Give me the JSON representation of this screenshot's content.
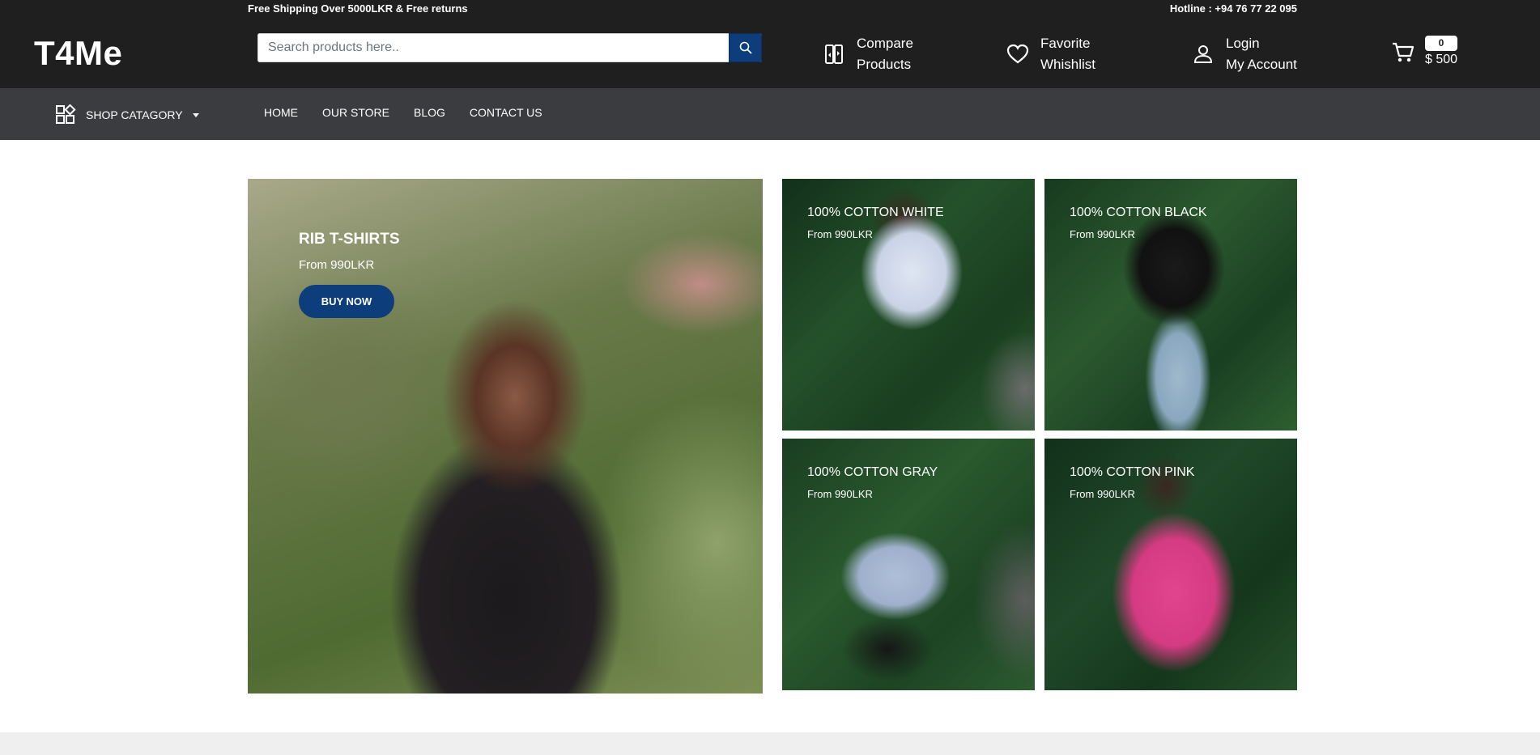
{
  "topbar": {
    "shipping": "Free Shipping Over 5000LKR & Free returns",
    "hotline": "Hotline : +94 76 77 22 095"
  },
  "header": {
    "logo": "T4Me",
    "search": {
      "placeholder": "Search products here.."
    },
    "compare": {
      "line1": "Compare",
      "line2": "Products"
    },
    "favorite": {
      "line1": "Favorite",
      "line2": "Whishlist"
    },
    "account": {
      "line1": "Login",
      "line2": "My Account"
    },
    "cart": {
      "count": "0",
      "total": "$ 500"
    }
  },
  "nav": {
    "shop_category": "SHOP CATAGORY",
    "items": [
      "HOME",
      "OUR STORE",
      "BLOG",
      "CONTACT US"
    ]
  },
  "hero": {
    "title": "RIB T-SHIRTS",
    "price": "From 990LKR",
    "button": "BUY NOW"
  },
  "tiles": [
    {
      "title": "100% COTTON WHITE",
      "price": "From 990LKR"
    },
    {
      "title": "100% COTTON BLACK",
      "price": "From 990LKR"
    },
    {
      "title": "100% COTTON GRAY",
      "price": "From 990LKR"
    },
    {
      "title": "100% COTTON PINK",
      "price": "From 990LKR"
    }
  ],
  "colors": {
    "header_bg": "#1f1f20",
    "nav_bg": "#3b3c3f",
    "accent": "#0d3d7a"
  },
  "icons": [
    "search-icon",
    "compare-icon",
    "heart-icon",
    "user-icon",
    "cart-icon",
    "category-grid-icon",
    "caret-down-icon"
  ]
}
